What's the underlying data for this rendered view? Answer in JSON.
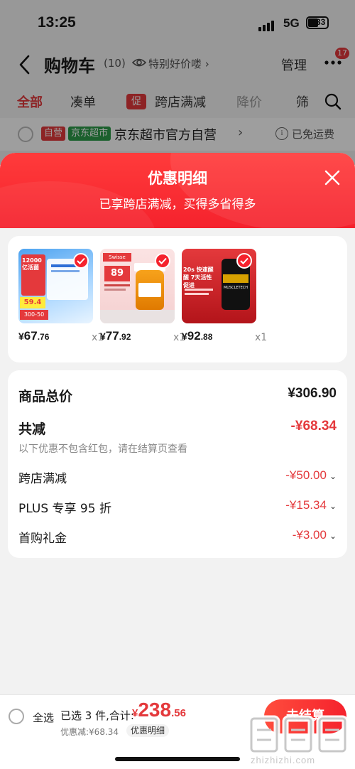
{
  "status_bar": {
    "time": "13:25",
    "network": "5G",
    "battery": "33"
  },
  "header": {
    "title": "购物车",
    "count": "(10)",
    "hot_label": "特别好价喽 ›",
    "manage": "管理",
    "more_badge": "17"
  },
  "filters": {
    "all": "全部",
    "combine": "凑单",
    "promo_tag": "促",
    "cross_store": "跨店满减",
    "price_drop": "降价",
    "filter": "筛"
  },
  "store": {
    "tag_self": "自营",
    "tag_super": "京东超市",
    "name": "京东超市官方自营",
    "chevron": "›",
    "free_ship": "已免运费"
  },
  "popup": {
    "title": "优惠明细",
    "subtitle": "已享跨店满减，买得多省得多",
    "products": [
      {
        "name": "product-1",
        "price_symbol": "¥",
        "price_int": "67",
        "price_dec": ".76",
        "qty": "x1",
        "img_text": "12000 亿活菌",
        "img_sub": "59.4",
        "img_badge": "300-50"
      },
      {
        "name": "product-2",
        "price_symbol": "¥",
        "price_int": "77",
        "price_dec": ".92",
        "qty": "x1",
        "img_text": "Swisse",
        "img_sub": "89"
      },
      {
        "name": "product-3",
        "price_symbol": "¥",
        "price_int": "92",
        "price_dec": ".88",
        "qty": "x1",
        "img_text": "20s 快速醒醒 7天活性促进",
        "img_sub": "MUSCLETECH"
      }
    ],
    "summary": {
      "total_label": "商品总价",
      "total_value": "¥306.90",
      "reduce_label": "共减",
      "reduce_value": "-¥68.34",
      "note": "以下优惠不包含红包，请在结算页查看",
      "items": [
        {
          "label": "跨店满减",
          "value": "-¥50.00"
        },
        {
          "label": "PLUS 专享 95 折",
          "value": "-¥15.34"
        },
        {
          "label": "首购礼金",
          "value": "-¥3.00"
        }
      ]
    }
  },
  "bottom_bar": {
    "select_all": "全选",
    "selected": "已选 3 件,合计:",
    "total_symbol": "¥",
    "total_int": "238",
    "total_dec": ".56",
    "saved": "优惠减:¥68.34",
    "detail": "优惠明细",
    "checkout": "去结算",
    "watermark_url": "zhizhizhi.com"
  },
  "colors": {
    "accent": "#e4393c",
    "header_red": "#f5222d",
    "green_tag": "#2d9c4a"
  }
}
